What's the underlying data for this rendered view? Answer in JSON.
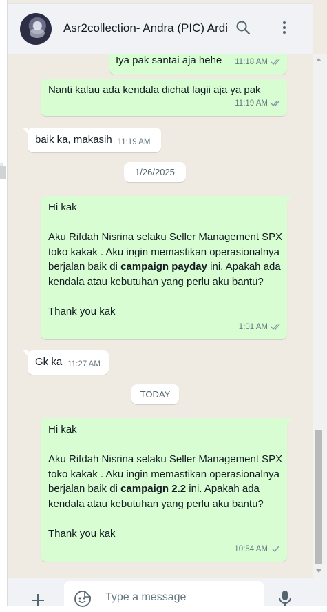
{
  "header": {
    "title": "Asr2collection- Andra (PIC) Ardi",
    "search_icon": "search-icon",
    "menu_icon": "more-vertical-icon"
  },
  "messages": [
    {
      "dir": "out",
      "text": "Iya pak santai aja hehe",
      "time": "11:18 AM",
      "status": "read"
    },
    {
      "dir": "out",
      "text": "Nanti kalau ada kendala dichat lagii aja ya pak",
      "time": "11:19 AM",
      "status": "read"
    },
    {
      "dir": "in",
      "text": "baik ka, makasih",
      "time": "11:19 AM"
    },
    {
      "type": "date",
      "label": "1/26/2025"
    },
    {
      "dir": "out",
      "greeting": "Hi kak",
      "body_start": "Aku Rifdah Nisrina selaku Seller Management SPX toko kakak . Aku ingin memastikan operasionalnya berjalan baik di",
      "body_bold": "campaign payday",
      "body_end": "ini. Apakah ada kendala atau kebutuhan yang perlu aku bantu?",
      "closing": "Thank you kak",
      "time": "1:01 AM",
      "status": "read"
    },
    {
      "dir": "in",
      "text": "Gk ka",
      "time": "11:27 AM"
    },
    {
      "type": "date",
      "label": "TODAY"
    },
    {
      "dir": "out",
      "greeting": "Hi kak",
      "body_start": "Aku Rifdah Nisrina selaku Seller Management SPX toko kakak . Aku ingin memastikan operasionalnya berjalan baik di",
      "body_bold": "campaign 2.2",
      "body_end": "ini. Apakah ada kendala atau kebutuhan yang perlu aku bantu?",
      "closing": "Thank you kak",
      "time": "10:54 AM",
      "status": "delivered"
    }
  ],
  "composer": {
    "placeholder": "Type a message",
    "attach_icon": "plus-icon",
    "emoji_icon": "sticker-emoji-icon",
    "mic_icon": "microphone-icon"
  },
  "colors": {
    "outgoing_bubble": "#d9fdd3",
    "incoming_bubble": "#ffffff",
    "chat_background": "#efeae2",
    "header_background": "#f0f2f5",
    "read_ticks": "#8696a0"
  }
}
